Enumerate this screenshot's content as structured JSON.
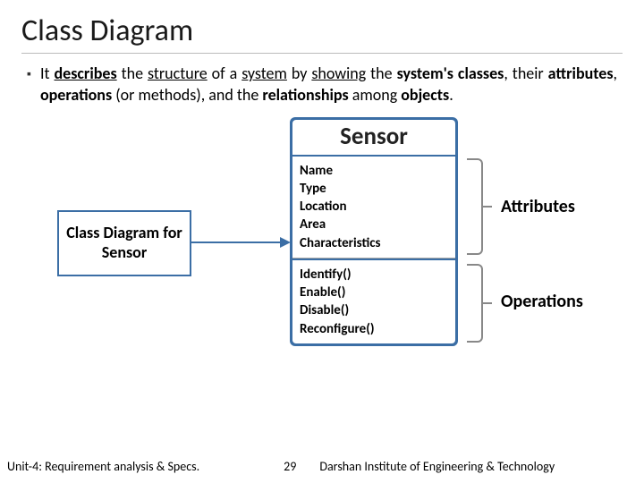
{
  "title": "Class Diagram",
  "bullet": {
    "marker": "▪",
    "parts": {
      "p1": "It",
      "p2": "describes",
      "p3": "the",
      "p4": "structure",
      "p5": "of a",
      "p6": "system",
      "p7": "by",
      "p8": "showing",
      "p9": "the",
      "p10": "system's classes",
      "p11": ", their ",
      "p12": "attributes",
      "p13": ", ",
      "p14": "operations",
      "p15": " (or methods), and the ",
      "p16": "relationships",
      "p17": " among ",
      "p18": "objects",
      "p19": "."
    }
  },
  "label_box": "Class Diagram for Sensor",
  "class": {
    "name": "Sensor",
    "attributes": [
      "Name",
      "Type",
      "Location",
      "Area",
      "Characteristics"
    ],
    "operations": [
      "Identify()",
      "Enable()",
      "Disable()",
      "Reconfigure()"
    ]
  },
  "side": {
    "attributes": "Attributes",
    "operations": "Operations"
  },
  "footer": {
    "left": "Unit-4: Requirement analysis & Specs.",
    "page": "29",
    "right": "Darshan Institute of Engineering & Technology"
  }
}
